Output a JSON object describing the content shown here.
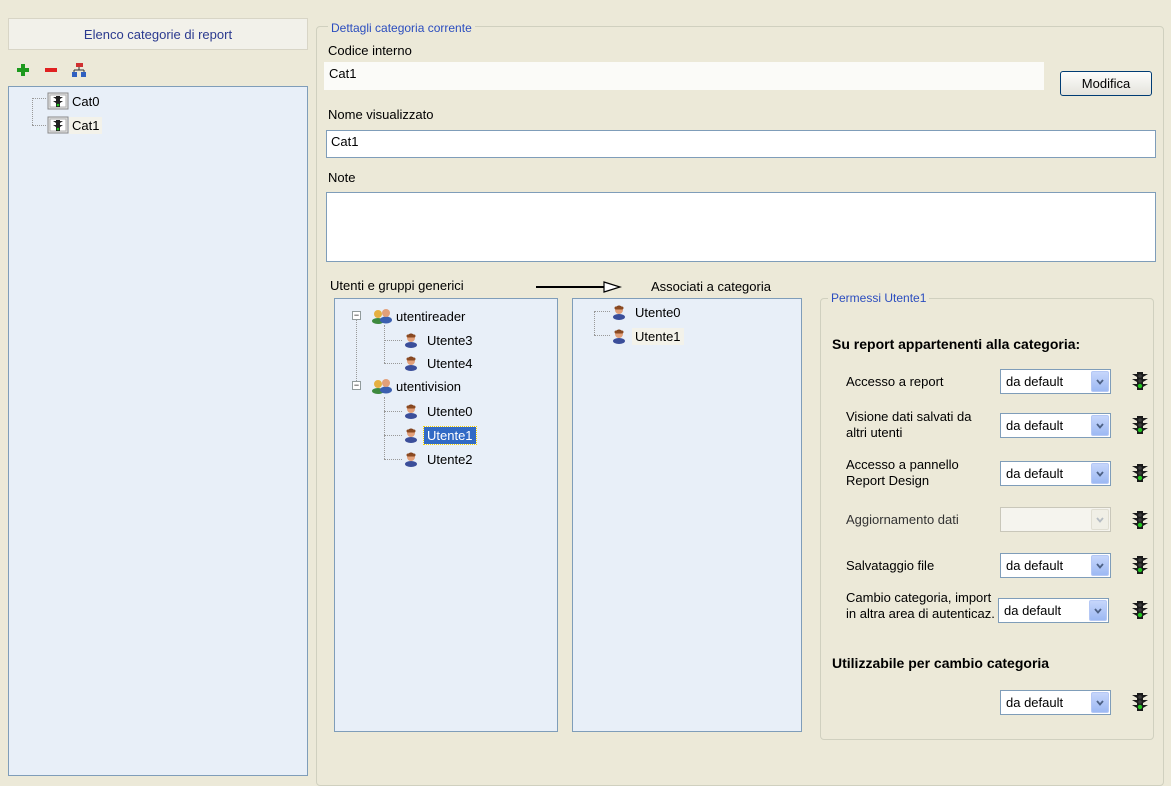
{
  "left_panel": {
    "header": "Elenco categorie di report",
    "toolbar": {
      "add": "add-icon",
      "remove": "remove-icon",
      "tree": "hierarchy-icon"
    },
    "categories": [
      {
        "label": "Cat0",
        "selected": false
      },
      {
        "label": "Cat1",
        "selected": true
      }
    ]
  },
  "details": {
    "legend": "Dettagli categoria corrente",
    "internal_code_label": "Codice interno",
    "internal_code_value": "Cat1",
    "modify_button": "Modifica",
    "display_name_label": "Nome visualizzato",
    "display_name_value": "Cat1",
    "notes_label": "Note",
    "notes_value": ""
  },
  "users_panel": {
    "generic_label": "Utenti e gruppi generici",
    "associated_label": "Associati a categoria",
    "groups": [
      {
        "name": "utentireader",
        "members": [
          "Utente3",
          "Utente4"
        ]
      },
      {
        "name": "utentivision",
        "members": [
          "Utente0",
          "Utente1",
          "Utente2"
        ]
      }
    ],
    "selected_user": "Utente1",
    "associated": [
      "Utente0",
      "Utente1"
    ]
  },
  "permissions": {
    "legend": "Permessi Utente1",
    "section_title": "Su report appartenenti alla categoria:",
    "rows": [
      {
        "label": "Accesso a report",
        "value": "da default",
        "enabled": true
      },
      {
        "label": "Visione dati salvati da altri utenti",
        "value": "da default",
        "enabled": true
      },
      {
        "label": "Accesso a pannello Report Design",
        "value": "da default",
        "enabled": true
      },
      {
        "label": "Aggiornamento dati",
        "value": "",
        "enabled": false
      },
      {
        "label": "Salvataggio file",
        "value": "da default",
        "enabled": true
      },
      {
        "label": "Cambio categoria, import in altra area di autenticaz.",
        "value": "da default",
        "enabled": true
      }
    ],
    "change_title": "Utilizzabile per cambio categoria",
    "change_value": "da default"
  },
  "colors": {
    "accent_blue": "#2b4dbf",
    "selection": "#316ac5",
    "tree_bg": "#e8eff8",
    "window_bg": "#ece9d8"
  }
}
